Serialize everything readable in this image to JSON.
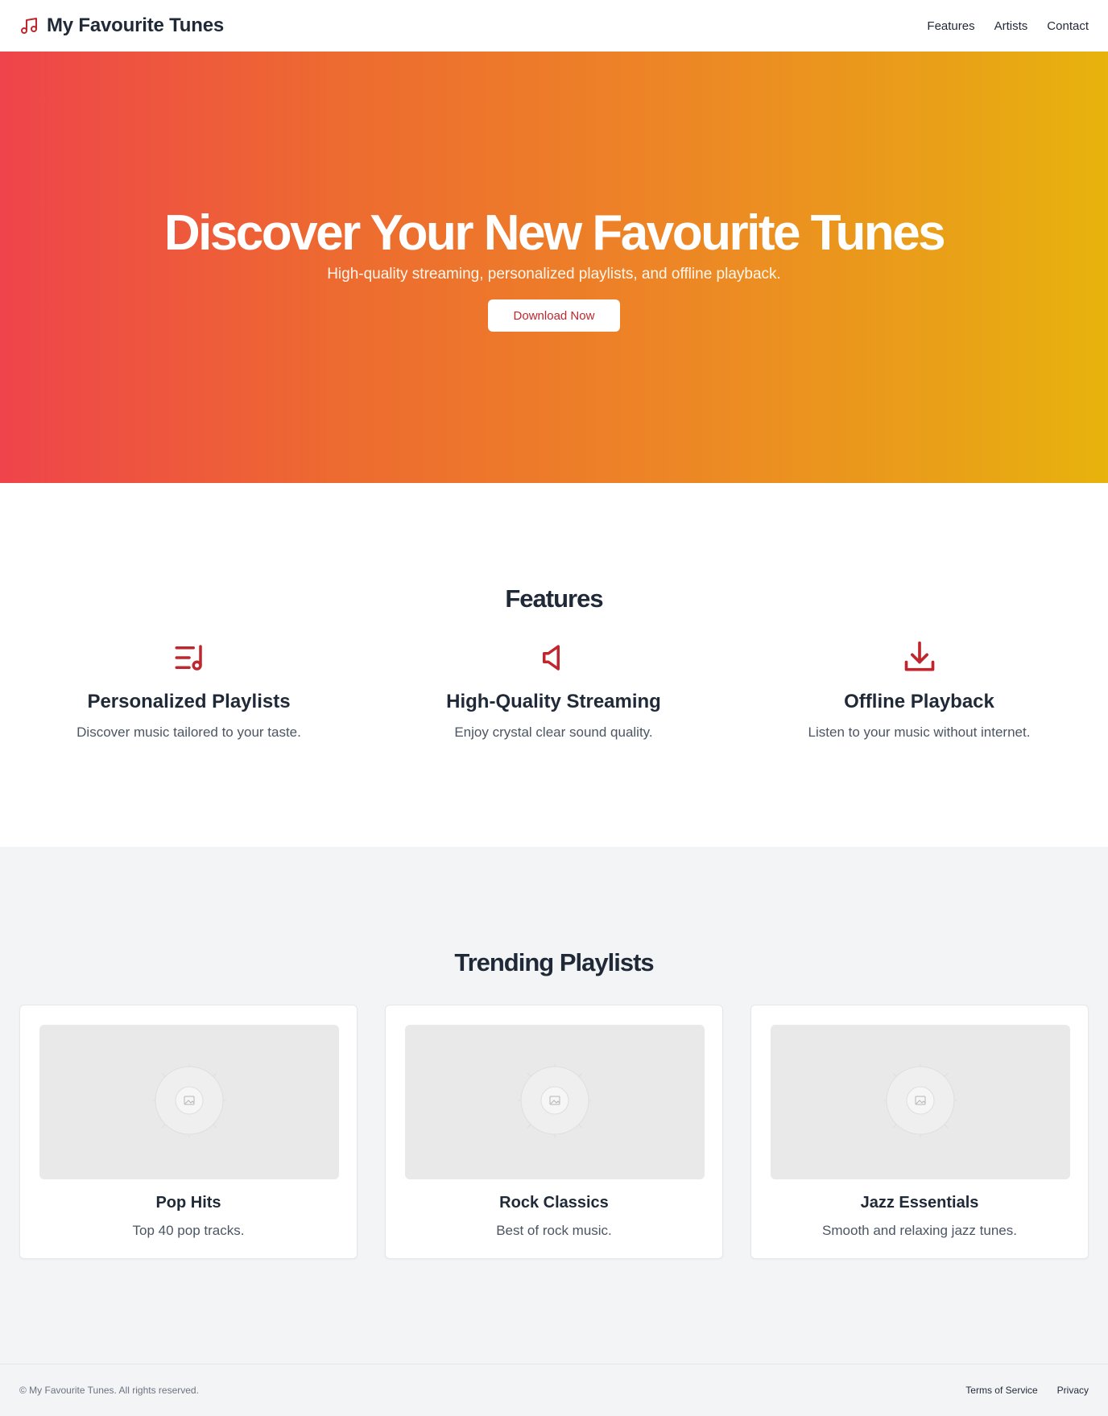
{
  "header": {
    "brand_icon": "music-note-icon",
    "title": "My Favourite Tunes",
    "nav": [
      {
        "label": "Features"
      },
      {
        "label": "Artists"
      },
      {
        "label": "Contact"
      }
    ]
  },
  "hero": {
    "title": "Discover Your New Favourite Tunes",
    "subtitle": "High-quality streaming, personalized playlists, and offline playback.",
    "cta_label": "Download Now",
    "gradient_colors": [
      "#ef444b",
      "#ed8526",
      "#e8b30c"
    ]
  },
  "features": {
    "title": "Features",
    "items": [
      {
        "icon": "playlist-icon",
        "title": "Personalized Playlists",
        "description": "Discover music tailored to your taste."
      },
      {
        "icon": "speaker-icon",
        "title": "High-Quality Streaming",
        "description": "Enjoy crystal clear sound quality."
      },
      {
        "icon": "download-icon",
        "title": "Offline Playback",
        "description": "Listen to your music without internet."
      }
    ]
  },
  "trending": {
    "title": "Trending Playlists",
    "cards": [
      {
        "image_icon": "image-placeholder-icon",
        "title": "Pop Hits",
        "description": "Top 40 pop tracks."
      },
      {
        "image_icon": "image-placeholder-icon",
        "title": "Rock Classics",
        "description": "Best of rock music."
      },
      {
        "image_icon": "image-placeholder-icon",
        "title": "Jazz Essentials",
        "description": "Smooth and relaxing jazz tunes."
      }
    ]
  },
  "footer": {
    "copyright": "© My Favourite Tunes. All rights reserved.",
    "links": [
      {
        "label": "Terms of Service"
      },
      {
        "label": "Privacy"
      }
    ]
  },
  "colors": {
    "accent": "#c0262d",
    "text": "#1f2937",
    "muted": "#4b5563",
    "section_bg": "#f3f4f6"
  }
}
